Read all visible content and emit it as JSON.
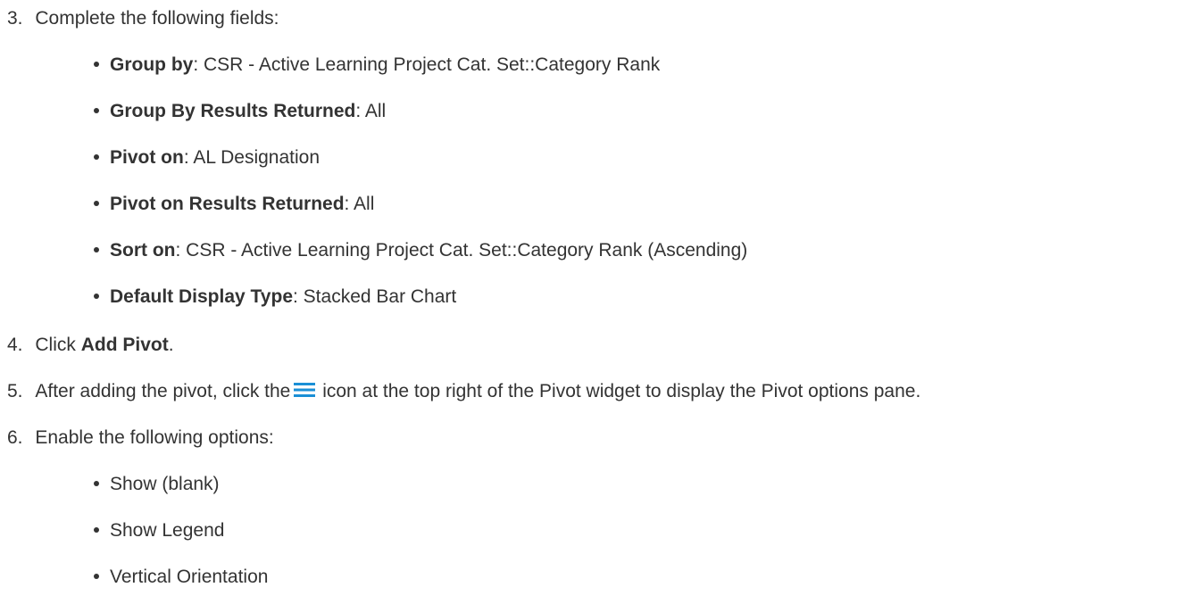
{
  "steps": [
    {
      "number": "3.",
      "text": "Complete the following fields:"
    },
    {
      "number": "4.",
      "prefix": "Click ",
      "bold": "Add Pivot",
      "suffix": "."
    },
    {
      "number": "5.",
      "before_icon": "After adding the pivot, click the",
      "after_icon": "icon at the top right of the Pivot widget to display the Pivot options pane.",
      "icon": "hamburger-menu-icon",
      "icon_color": "#1a8fd6"
    },
    {
      "number": "6.",
      "text": "Enable the following options:"
    }
  ],
  "fields": [
    {
      "label": "Group by",
      "value": ": CSR - Active Learning Project Cat. Set::Category Rank"
    },
    {
      "label": "Group By Results Returned",
      "value": ": All"
    },
    {
      "label": "Pivot on",
      "value": ": AL Designation"
    },
    {
      "label": "Pivot on Results Returned",
      "value": ": All"
    },
    {
      "label": "Sort on",
      "value": ": CSR - Active Learning Project Cat. Set::Category Rank (Ascending)"
    },
    {
      "label": "Default Display Type",
      "value": ": Stacked Bar Chart"
    }
  ],
  "options": [
    "Show (blank)",
    "Show Legend",
    "Vertical Orientation"
  ],
  "colors": {
    "text": "#333333",
    "icon": "#1a8fd6"
  }
}
